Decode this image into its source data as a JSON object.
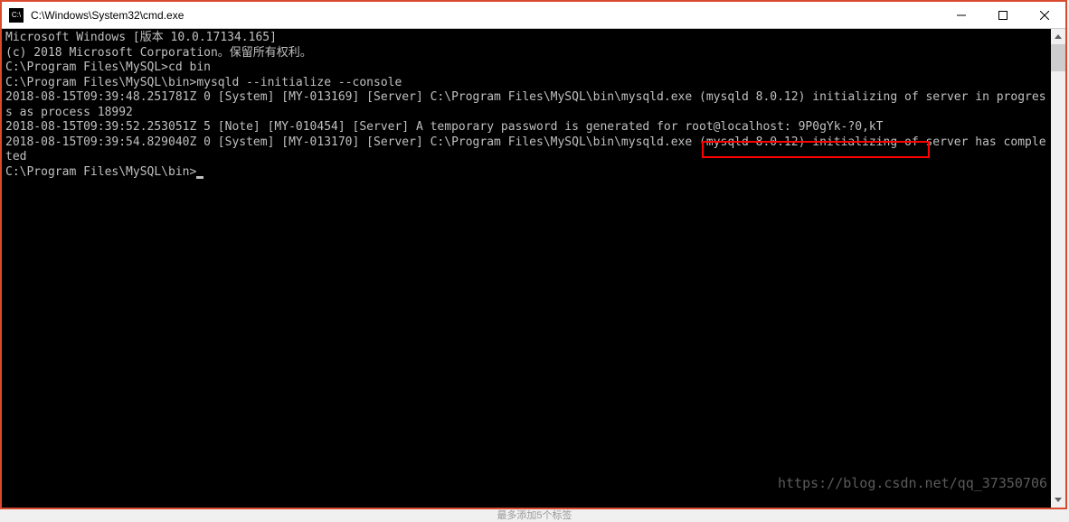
{
  "titlebar": {
    "icon_text": "C:\\",
    "title": "C:\\Windows\\System32\\cmd.exe"
  },
  "terminal": {
    "line1": "Microsoft Windows [版本 10.0.17134.165]",
    "line2": "(c) 2018 Microsoft Corporation。保留所有权利。",
    "blank1": "",
    "line3": "C:\\Program Files\\MySQL>cd bin",
    "blank2": "",
    "line4": "C:\\Program Files\\MySQL\\bin>mysqld --initialize --console",
    "line5": "2018-08-15T09:39:48.251781Z 0 [System] [MY-013169] [Server] C:\\Program Files\\MySQL\\bin\\mysqld.exe (mysqld 8.0.12) initializing of server in progress as process 18992",
    "line6a": "2018-08-15T09:39:52.253051Z 5 [Note] [MY-010454] [Server] A temporary password is generated for ",
    "line6_highlight": "root@localhost: 9P0gYk-?0,kT",
    "line7": "2018-08-15T09:39:54.829040Z 0 [System] [MY-013170] [Server] C:\\Program Files\\MySQL\\bin\\mysqld.exe (mysqld 8.0.12) initializing of server has completed",
    "blank3": "",
    "prompt": "C:\\Program Files\\MySQL\\bin>"
  },
  "watermark": "https://blog.csdn.net/qq_37350706",
  "footer": "最多添加5个标签"
}
